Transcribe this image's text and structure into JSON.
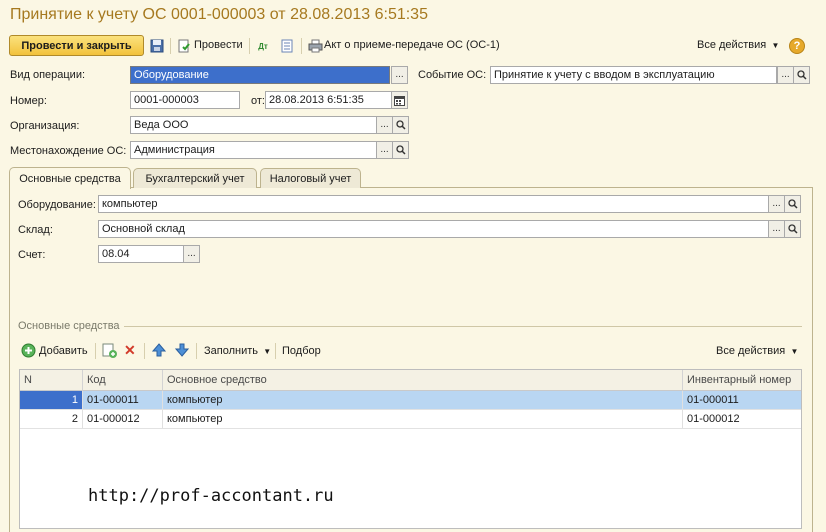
{
  "window": {
    "title": "Принятие к учету ОС 0001-000003 от 28.08.2013 6:51:35"
  },
  "toolbar": {
    "post_close": "Провести и закрыть",
    "post": "Провести",
    "act": "Акт о приеме-передаче ОС (ОС-1)",
    "all_actions": "Все действия",
    "help": "?"
  },
  "form": {
    "operation_label": "Вид операции:",
    "operation_value": "Оборудование",
    "event_label": "Событие ОС:",
    "event_value": "Принятие к учету с вводом в эксплуатацию",
    "number_label": "Номер:",
    "number_value": "0001-000003",
    "date_label": "от:",
    "date_value": "28.08.2013  6:51:35",
    "org_label": "Организация:",
    "org_value": "Веда ООО",
    "location_label": "Местонахождение ОС:",
    "location_value": "Администрация"
  },
  "tabs": [
    {
      "label": "Основные средства"
    },
    {
      "label": "Бухгалтерский учет"
    },
    {
      "label": "Налоговый учет"
    }
  ],
  "tab_main": {
    "equipment_label": "Оборудование:",
    "equipment_value": "компьютер",
    "warehouse_label": "Склад:",
    "warehouse_value": "Основной склад",
    "account_label": "Счет:",
    "account_value": "08.04"
  },
  "assets": {
    "section_title": "Основные средства",
    "add": "Добавить",
    "fill": "Заполнить",
    "select": "Подбор",
    "all_actions": "Все действия",
    "columns": [
      "N",
      "Код",
      "Основное средство",
      "Инвентарный номер"
    ],
    "rows": [
      {
        "n": "1",
        "code": "01-000011",
        "asset": "компьютер",
        "inv": "01-000011"
      },
      {
        "n": "2",
        "code": "01-000012",
        "asset": "компьютер",
        "inv": "01-000012"
      }
    ]
  },
  "watermark": "http://prof-accontant.ru"
}
